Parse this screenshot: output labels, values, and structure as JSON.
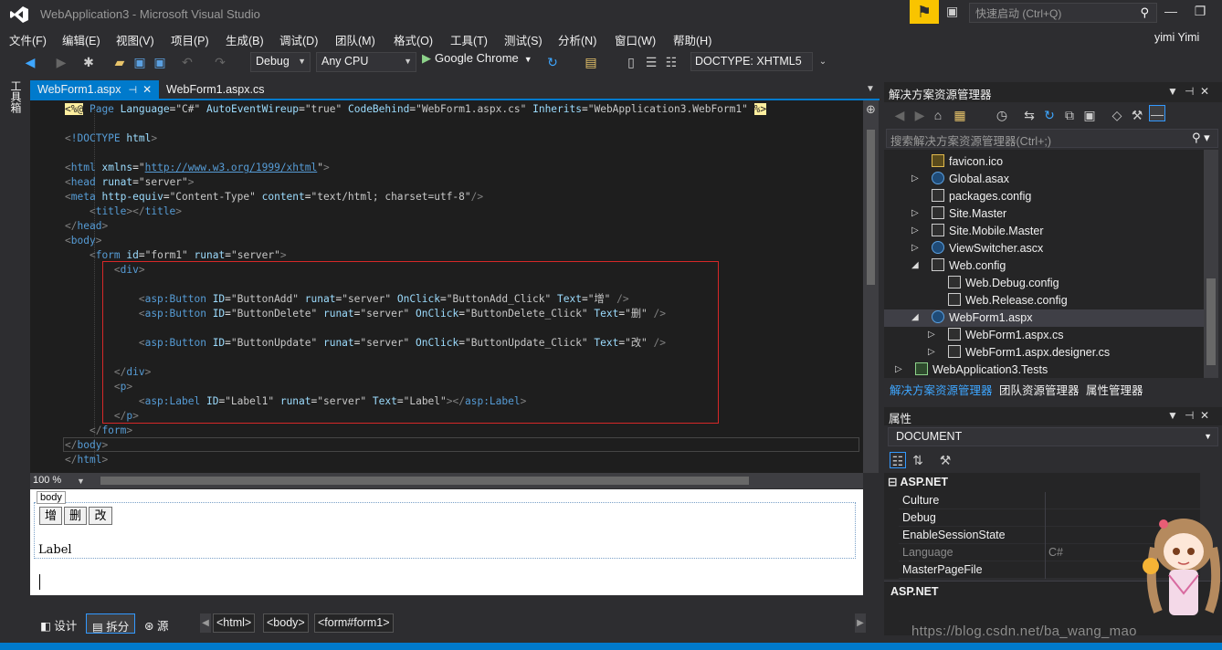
{
  "window": {
    "title": "WebApplication3 - Microsoft Visual Studio",
    "quick_launch_placeholder": "快速启动 (Ctrl+Q)",
    "user": "yimi Yimi"
  },
  "menu": [
    "文件(F)",
    "编辑(E)",
    "视图(V)",
    "项目(P)",
    "生成(B)",
    "调试(D)",
    "团队(M)",
    "格式(O)",
    "工具(T)",
    "测试(S)",
    "分析(N)",
    "窗口(W)",
    "帮助(H)"
  ],
  "toolbar": {
    "configuration": "Debug",
    "platform": "Any CPU",
    "run_target": "Google Chrome",
    "doctype": "DOCTYPE: XHTML5"
  },
  "toolbox_label": "工具箱",
  "tabs": [
    {
      "label": "WebForm1.aspx",
      "active": true
    },
    {
      "label": "WebForm1.aspx.cs",
      "active": false
    }
  ],
  "code_lines": [
    {
      "html": "<span class=\"directive\">&lt;%@</span> <span class=\"tag\">Page</span> <span class=\"attr\">Language</span>=<span class=\"str\">\"C#\"</span> <span class=\"attr\">AutoEventWireup</span>=<span class=\"str\">\"true\"</span> <span class=\"attr\">CodeBehind</span>=<span class=\"str\">\"WebForm1.aspx.cs\"</span> <span class=\"attr\">Inherits</span>=<span class=\"str\">\"WebApplication3.WebForm1\"</span> <span class=\"directive\">%&gt;</span>"
    },
    {
      "html": ""
    },
    {
      "html": "<span class=\"bracket\">&lt;</span><span class=\"tag\">!DOCTYPE</span> <span class=\"attr\">html</span><span class=\"bracket\">&gt;</span>"
    },
    {
      "html": ""
    },
    {
      "html": "<span class=\"bracket\">&lt;</span><span class=\"tag\">html</span> <span class=\"attr\">xmlns</span>=<span class=\"str\">\"</span><span class=\"url\">http://www.w3.org/1999/xhtml</span><span class=\"str\">\"</span><span class=\"bracket\">&gt;</span>"
    },
    {
      "html": "<span class=\"bracket\">&lt;</span><span class=\"tag\">head</span> <span class=\"attr\">runat</span>=<span class=\"str\">\"server\"</span><span class=\"bracket\">&gt;</span>"
    },
    {
      "html": "<span class=\"bracket\">&lt;</span><span class=\"tag\">meta</span> <span class=\"attr\">http-equiv</span>=<span class=\"str\">\"Content-Type\"</span> <span class=\"attr\">content</span>=<span class=\"str\">\"text/html; charset=utf-8\"</span><span class=\"bracket\">/&gt;</span>"
    },
    {
      "html": "    <span class=\"bracket\">&lt;</span><span class=\"tag\">title</span><span class=\"bracket\">&gt;&lt;/</span><span class=\"tag\">title</span><span class=\"bracket\">&gt;</span>"
    },
    {
      "html": "<span class=\"bracket\">&lt;/</span><span class=\"tag\">head</span><span class=\"bracket\">&gt;</span>"
    },
    {
      "html": "<span class=\"bracket\">&lt;</span><span class=\"tag\">body</span><span class=\"bracket\">&gt;</span>"
    },
    {
      "html": "    <span class=\"bracket\">&lt;</span><span class=\"tag\">form</span> <span class=\"attr\">id</span>=<span class=\"str\">\"form1\"</span> <span class=\"attr\">runat</span>=<span class=\"str\">\"server\"</span><span class=\"bracket\">&gt;</span>"
    },
    {
      "html": "        <span class=\"bracket\">&lt;</span><span class=\"tag\">div</span><span class=\"bracket\">&gt;</span>"
    },
    {
      "html": ""
    },
    {
      "html": "            <span class=\"bracket\">&lt;</span><span class=\"tag\">asp:Button</span> <span class=\"attr\">ID</span>=<span class=\"str\">\"ButtonAdd\"</span> <span class=\"attr\">runat</span>=<span class=\"str\">\"server\"</span> <span class=\"attr\">OnClick</span>=<span class=\"str\">\"ButtonAdd_Click\"</span> <span class=\"attr\">Text</span>=<span class=\"str\">\"增\"</span> <span class=\"bracket\">/&gt;</span>"
    },
    {
      "html": "            <span class=\"bracket\">&lt;</span><span class=\"tag\">asp:Button</span> <span class=\"attr\">ID</span>=<span class=\"str\">\"ButtonDelete\"</span> <span class=\"attr\">runat</span>=<span class=\"str\">\"server\"</span> <span class=\"attr\">OnClick</span>=<span class=\"str\">\"ButtonDelete_Click\"</span> <span class=\"attr\">Text</span>=<span class=\"str\">\"删\"</span> <span class=\"bracket\">/&gt;</span>"
    },
    {
      "html": ""
    },
    {
      "html": "            <span class=\"bracket\">&lt;</span><span class=\"tag\">asp:Button</span> <span class=\"attr\">ID</span>=<span class=\"str\">\"ButtonUpdate\"</span> <span class=\"attr\">runat</span>=<span class=\"str\">\"server\"</span> <span class=\"attr\">OnClick</span>=<span class=\"str\">\"ButtonUpdate_Click\"</span> <span class=\"attr\">Text</span>=<span class=\"str\">\"改\"</span> <span class=\"bracket\">/&gt;</span>"
    },
    {
      "html": ""
    },
    {
      "html": "        <span class=\"bracket\">&lt;/</span><span class=\"tag\">div</span><span class=\"bracket\">&gt;</span>"
    },
    {
      "html": "        <span class=\"bracket\">&lt;</span><span class=\"tag\">p</span><span class=\"bracket\">&gt;</span>"
    },
    {
      "html": "            <span class=\"bracket\">&lt;</span><span class=\"tag\">asp:Label</span> <span class=\"attr\">ID</span>=<span class=\"str\">\"Label1\"</span> <span class=\"attr\">runat</span>=<span class=\"str\">\"server\"</span> <span class=\"attr\">Text</span>=<span class=\"str\">\"Label\"</span><span class=\"bracket\">&gt;&lt;/</span><span class=\"tag\">asp:Label</span><span class=\"bracket\">&gt;</span>"
    },
    {
      "html": "        <span class=\"bracket\">&lt;/</span><span class=\"tag\">p</span><span class=\"bracket\">&gt;</span>"
    },
    {
      "html": "    <span class=\"bracket\">&lt;/</span><span class=\"tag\">form</span><span class=\"bracket\">&gt;</span>"
    },
    {
      "html": "<span class=\"bracket\">&lt;/</span><span class=\"tag\">body</span><span class=\"bracket\">&gt;</span>"
    },
    {
      "html": "<span class=\"bracket\">&lt;/</span><span class=\"tag\">html</span><span class=\"bracket\">&gt;</span>"
    }
  ],
  "editor": {
    "zoom": "100 %"
  },
  "design": {
    "body_tag": "body",
    "buttons": [
      "增",
      "删",
      "改"
    ],
    "label": "Label"
  },
  "views": {
    "design": "设计",
    "split": "拆分",
    "source": "源"
  },
  "breadcrumbs": [
    "<html>",
    "<body>",
    "<form#form1>"
  ],
  "solution_explorer": {
    "title": "解决方案资源管理器",
    "search_placeholder": "搜索解决方案资源管理器(Ctrl+;)",
    "items": [
      {
        "label": "favicon.ico",
        "type": "ico",
        "expander": ""
      },
      {
        "label": "Global.asax",
        "type": "web",
        "expander": "▷"
      },
      {
        "label": "packages.config",
        "type": "cfg",
        "expander": ""
      },
      {
        "label": "Site.Master",
        "type": "cfg",
        "expander": "▷"
      },
      {
        "label": "Site.Mobile.Master",
        "type": "cfg",
        "expander": "▷"
      },
      {
        "label": "ViewSwitcher.ascx",
        "type": "web",
        "expander": "▷"
      },
      {
        "label": "Web.config",
        "type": "cfg",
        "expander": "◢"
      },
      {
        "label": "Web.Debug.config",
        "type": "cfg",
        "expander": ""
      },
      {
        "label": "Web.Release.config",
        "type": "cfg",
        "expander": ""
      },
      {
        "label": "WebForm1.aspx",
        "type": "web",
        "expander": "◢"
      },
      {
        "label": "WebForm1.aspx.cs",
        "type": "cfg",
        "expander": "▷"
      },
      {
        "label": "WebForm1.aspx.designer.cs",
        "type": "cfg",
        "expander": "▷"
      },
      {
        "label": "WebApplication3.Tests",
        "type": "proj",
        "expander": "▷"
      }
    ],
    "bottom_tabs": [
      "解决方案资源管理器",
      "团队资源管理器",
      "属性管理器"
    ]
  },
  "properties": {
    "title": "属性",
    "object": "DOCUMENT",
    "category": "ASP.NET",
    "rows": [
      {
        "name": "Culture",
        "value": "",
        "dim": false
      },
      {
        "name": "Debug",
        "value": "",
        "dim": false
      },
      {
        "name": "EnableSessionState",
        "value": "",
        "dim": false
      },
      {
        "name": "Language",
        "value": "C#",
        "dim": true
      },
      {
        "name": "MasterPageFile",
        "value": "",
        "dim": false
      }
    ],
    "description_title": "ASP.NET"
  },
  "watermark": "https://blog.csdn.net/ba_wang_mao"
}
